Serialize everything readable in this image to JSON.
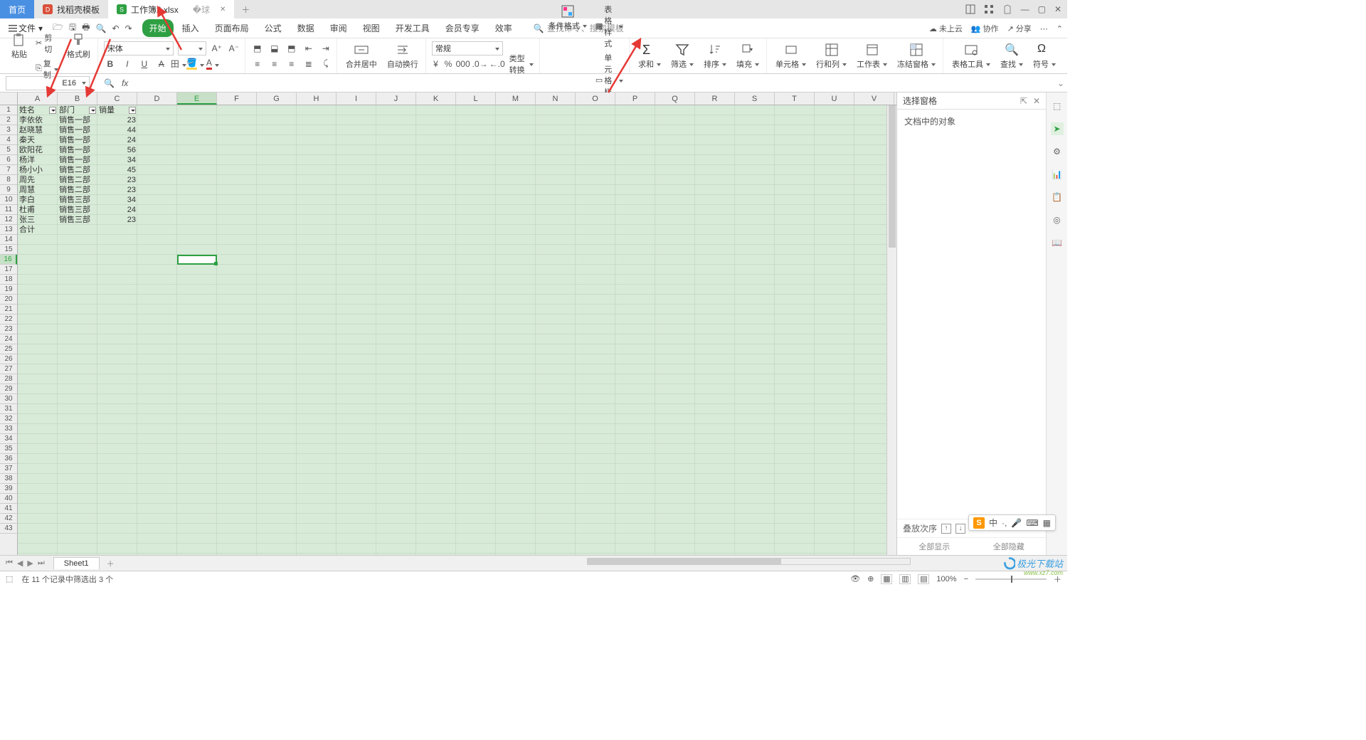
{
  "tabs": {
    "home": "首页",
    "tab1": "找稻壳模板",
    "tab2": "工作簿2.xlsx"
  },
  "menu": {
    "file": "文件",
    "items": [
      "开始",
      "插入",
      "页面布局",
      "公式",
      "数据",
      "审阅",
      "视图",
      "开发工具",
      "会员专享",
      "效率"
    ],
    "search_placeholder": "查找命令、搜索模板"
  },
  "menu_right": {
    "cloud": "未上云",
    "coop": "协作",
    "share": "分享"
  },
  "ribbon": {
    "paste": "粘贴",
    "cut": "剪切",
    "copy": "复制",
    "format_painter": "格式刷",
    "font_name": "宋体",
    "font_size": "",
    "merge_center": "合并居中",
    "wrap": "自动换行",
    "number_format": "常规",
    "type_convert": "类型转换",
    "cond_format": "条件格式",
    "table_style": "表格样式",
    "cell_style": "单元格样式",
    "sum": "求和",
    "filter": "筛选",
    "sort": "排序",
    "fill": "填充",
    "cell": "单元格",
    "rowcol": "行和列",
    "worksheet": "工作表",
    "freeze": "冻结窗格",
    "table_tools": "表格工具",
    "find": "查找",
    "symbol": "符号"
  },
  "formula_bar": {
    "cell_ref": "E16"
  },
  "columns": [
    "A",
    "B",
    "C",
    "D",
    "E",
    "F",
    "G",
    "H",
    "I",
    "J",
    "K",
    "L",
    "M",
    "N",
    "O",
    "P",
    "Q",
    "R",
    "S",
    "T",
    "U",
    "V"
  ],
  "col_widths": {
    "default": 56
  },
  "headers": {
    "a": "姓名",
    "b": "部门",
    "c": "销量"
  },
  "rows": [
    {
      "a": "李依依",
      "b": "销售一部",
      "c": "23"
    },
    {
      "a": "赵晓慧",
      "b": "销售一部",
      "c": "44"
    },
    {
      "a": "秦天",
      "b": "销售一部",
      "c": "24"
    },
    {
      "a": "欧阳花",
      "b": "销售一部",
      "c": "56"
    },
    {
      "a": "杨洋",
      "b": "销售一部",
      "c": "34"
    },
    {
      "a": "杨小小",
      "b": "销售二部",
      "c": "45"
    },
    {
      "a": "周先",
      "b": "销售二部",
      "c": "23"
    },
    {
      "a": "周慧",
      "b": "销售二部",
      "c": "23"
    },
    {
      "a": "李白",
      "b": "销售三部",
      "c": "34"
    },
    {
      "a": "杜甫",
      "b": "销售三部",
      "c": "24"
    },
    {
      "a": "张三",
      "b": "销售三部",
      "c": "23"
    },
    {
      "a": "合计",
      "b": "",
      "c": ""
    }
  ],
  "row_count_visible": 43,
  "right_pane": {
    "title": "选择窗格",
    "subtitle": "文档中的对象",
    "stack": "叠放次序",
    "show_all": "全部显示",
    "hide_all": "全部隐藏"
  },
  "sheet": {
    "name": "Sheet1"
  },
  "status": {
    "records": "在 11 个记录中筛选出 3 个",
    "zoom": "100%"
  },
  "ime": {
    "lang": "中"
  },
  "watermark": {
    "site": "极光下载站",
    "domain": "www.xz7.com"
  }
}
